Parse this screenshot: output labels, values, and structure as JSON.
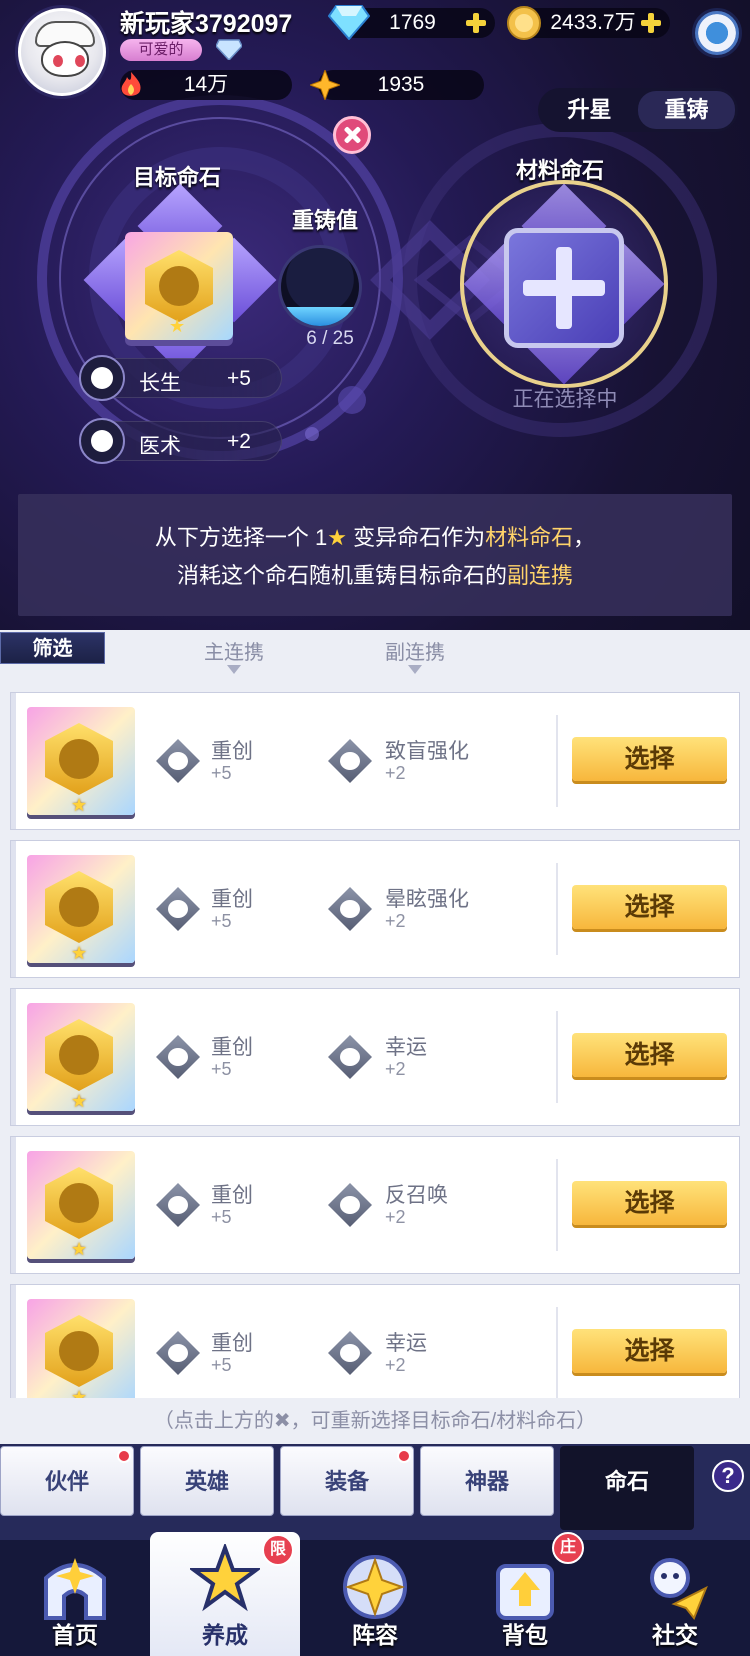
{
  "header": {
    "username": "新玩家3792097",
    "title_badge": "可爱的",
    "gems": "1769",
    "gold": "2433.7万",
    "power": "14万",
    "stars": "1935"
  },
  "mode_toggle": {
    "tabs": [
      "升星",
      "重铸"
    ],
    "active": "重铸"
  },
  "target": {
    "label": "目标命石",
    "star_count": 1
  },
  "recast": {
    "label": "重铸值",
    "current": 6,
    "max": 25,
    "text": "6 / 25"
  },
  "target_stats": [
    {
      "name": "长生",
      "value": "+5"
    },
    {
      "name": "医术",
      "value": "+2"
    }
  ],
  "material": {
    "label": "材料命石",
    "status": "正在选择中"
  },
  "hint": {
    "line1_pre": "从下方选择一个 1",
    "line1_star": "★",
    "line1_mid": " 变异命石作为",
    "line1_hl": "材料命石",
    "line1_post": "，",
    "line2_pre": "消耗这个命石随机重铸目标命石的",
    "line2_hl": "副连携"
  },
  "list": {
    "filter_label": "筛选",
    "col_main": "主连携",
    "col_sub": "副连携",
    "select_label": "选择",
    "rows": [
      {
        "main_name": "重创",
        "main_val": "+5",
        "sub_name": "致盲强化",
        "sub_val": "+2",
        "star": "★"
      },
      {
        "main_name": "重创",
        "main_val": "+5",
        "sub_name": "晕眩强化",
        "sub_val": "+2",
        "star": "★"
      },
      {
        "main_name": "重创",
        "main_val": "+5",
        "sub_name": "幸运",
        "sub_val": "+2",
        "star": "★"
      },
      {
        "main_name": "重创",
        "main_val": "+5",
        "sub_name": "反召唤",
        "sub_val": "+2",
        "star": "★"
      },
      {
        "main_name": "重创",
        "main_val": "+5",
        "sub_name": "幸运",
        "sub_val": "+2",
        "star": "★"
      }
    ]
  },
  "bottom_hint": "（点击上方的✖，可重新选择目标命石/材料命石）",
  "subtabs": [
    {
      "label": "伙伴",
      "dot": true
    },
    {
      "label": "英雄",
      "dot": false
    },
    {
      "label": "装备",
      "dot": true
    },
    {
      "label": "神器",
      "dot": false
    },
    {
      "label": "命石",
      "dot": false,
      "active": true
    }
  ],
  "help_label": "?",
  "nav": [
    {
      "label": "首页",
      "badge": ""
    },
    {
      "label": "养成",
      "badge": "限",
      "active": true
    },
    {
      "label": "阵容",
      "badge": ""
    },
    {
      "label": "背包",
      "badge": "庄"
    },
    {
      "label": "社交",
      "badge": ""
    }
  ],
  "colors": {
    "accent_gold": "#ffd36a",
    "badge_red": "#e73b4a",
    "panel_dark": "#1a1b3a"
  }
}
